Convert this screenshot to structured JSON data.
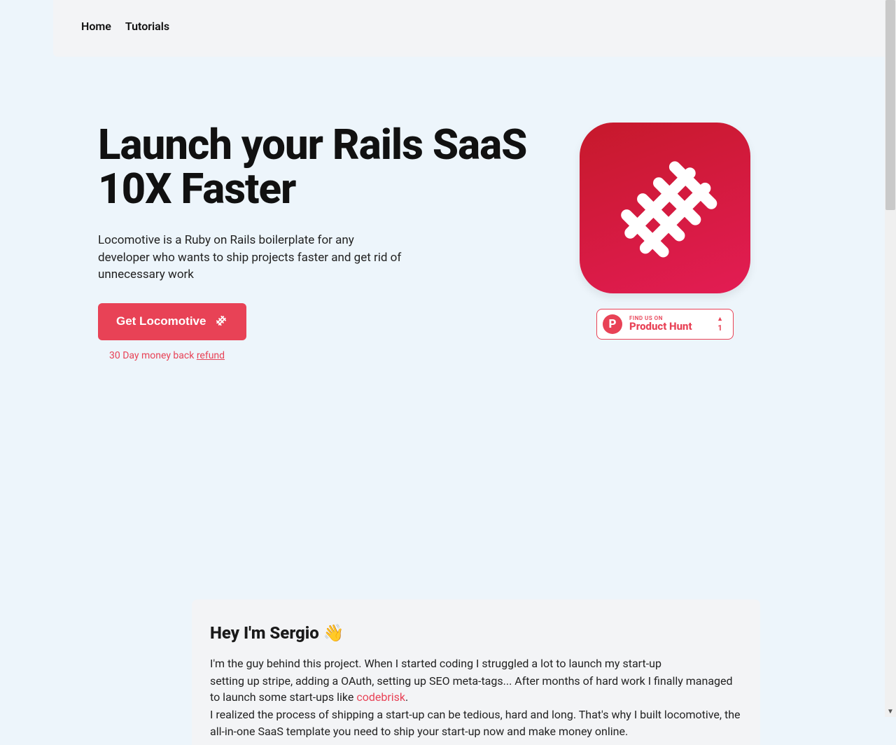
{
  "nav": {
    "home": "Home",
    "tutorials": "Tutorials"
  },
  "hero": {
    "title": "Launch your Rails SaaS 10X Faster",
    "lead": "Locomotive is a Ruby on Rails boilerplate for any developer who wants to ship projects faster and get rid of unnecessary work",
    "cta": "Get Locomotive",
    "refund_prefix": "30 Day money back ",
    "refund_link": "refund"
  },
  "ph": {
    "letter": "P",
    "small": "FIND US ON",
    "big": "Product Hunt",
    "count": "1"
  },
  "bio": {
    "heading": "Hey I'm Sergio 👋",
    "p1": "I'm the guy behind this project. When I started coding I struggled a lot to launch my start-up",
    "p2a": "setting up stripe, adding a OAuth, setting up SEO meta-tags... After months of hard work I finally managed to launch some start-ups like ",
    "p2link": "codebrisk",
    "p2b": ".",
    "p3": "I realized the process of shipping a start-up can be tedious, hard and long. That's why I built locomotive, the all-in-one SaaS template you need to ship your start-up now and make money online."
  }
}
